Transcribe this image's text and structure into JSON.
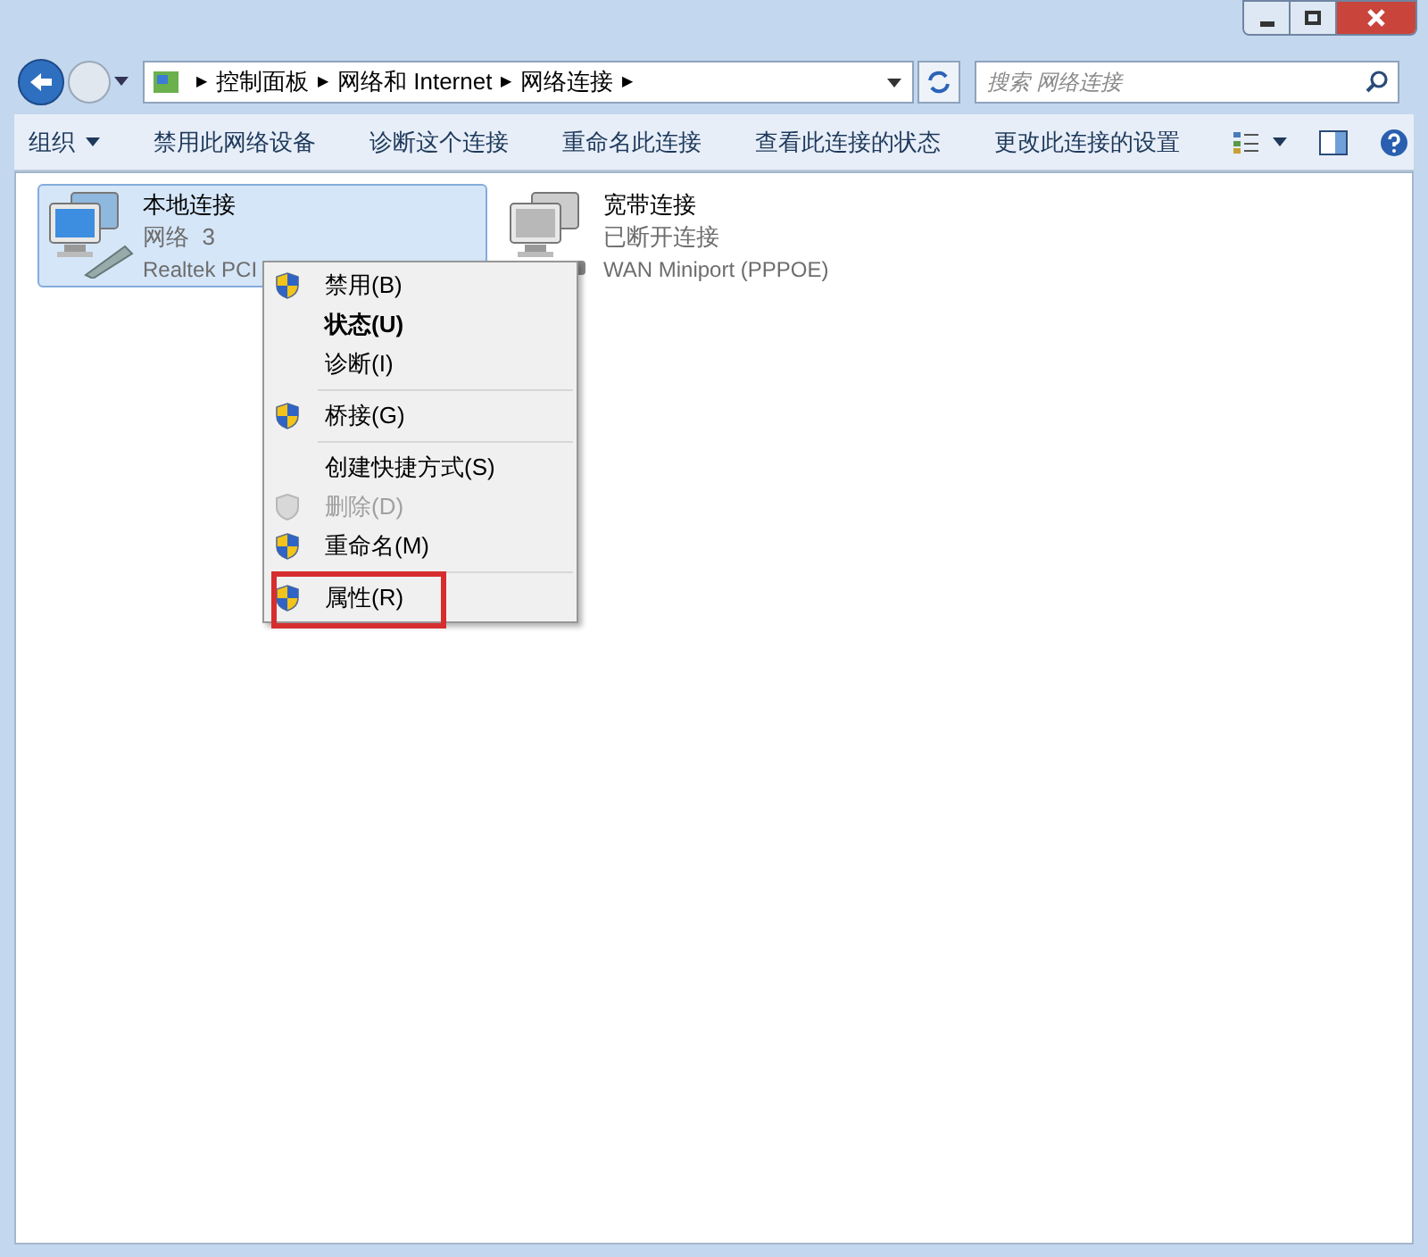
{
  "address_bar": {
    "separator": "▶",
    "segments": [
      "控制面板",
      "网络和 Internet",
      "网络连接"
    ]
  },
  "search": {
    "placeholder": "搜索 网络连接"
  },
  "toolbar": {
    "items": [
      "组织",
      "禁用此网络设备",
      "诊断这个连接",
      "重命名此连接",
      "查看此连接的状态",
      "更改此连接的设置"
    ]
  },
  "connections": [
    {
      "name": "本地连接",
      "status": "网络  3",
      "device": "Realtek PCI",
      "selected": true,
      "connected": true
    },
    {
      "name": "宽带连接",
      "status": "已断开连接",
      "device": "WAN Miniport (PPPOE)",
      "selected": false,
      "connected": false
    }
  ],
  "context_menu": {
    "items": [
      {
        "kind": "item",
        "label": "禁用(B)",
        "shield": true,
        "bold": false,
        "disabled": false,
        "highlighted": false
      },
      {
        "kind": "item",
        "label": "状态(U)",
        "shield": false,
        "bold": true,
        "disabled": false,
        "highlighted": false
      },
      {
        "kind": "item",
        "label": "诊断(I)",
        "shield": false,
        "bold": false,
        "disabled": false,
        "highlighted": false
      },
      {
        "kind": "separator"
      },
      {
        "kind": "item",
        "label": "桥接(G)",
        "shield": true,
        "bold": false,
        "disabled": false,
        "highlighted": false
      },
      {
        "kind": "separator"
      },
      {
        "kind": "item",
        "label": "创建快捷方式(S)",
        "shield": false,
        "bold": false,
        "disabled": false,
        "highlighted": false
      },
      {
        "kind": "item",
        "label": "删除(D)",
        "shield": true,
        "bold": false,
        "disabled": true,
        "highlighted": false
      },
      {
        "kind": "item",
        "label": "重命名(M)",
        "shield": true,
        "bold": false,
        "disabled": false,
        "highlighted": false
      },
      {
        "kind": "separator"
      },
      {
        "kind": "item",
        "label": "属性(R)",
        "shield": true,
        "bold": false,
        "disabled": false,
        "highlighted": true
      }
    ]
  }
}
